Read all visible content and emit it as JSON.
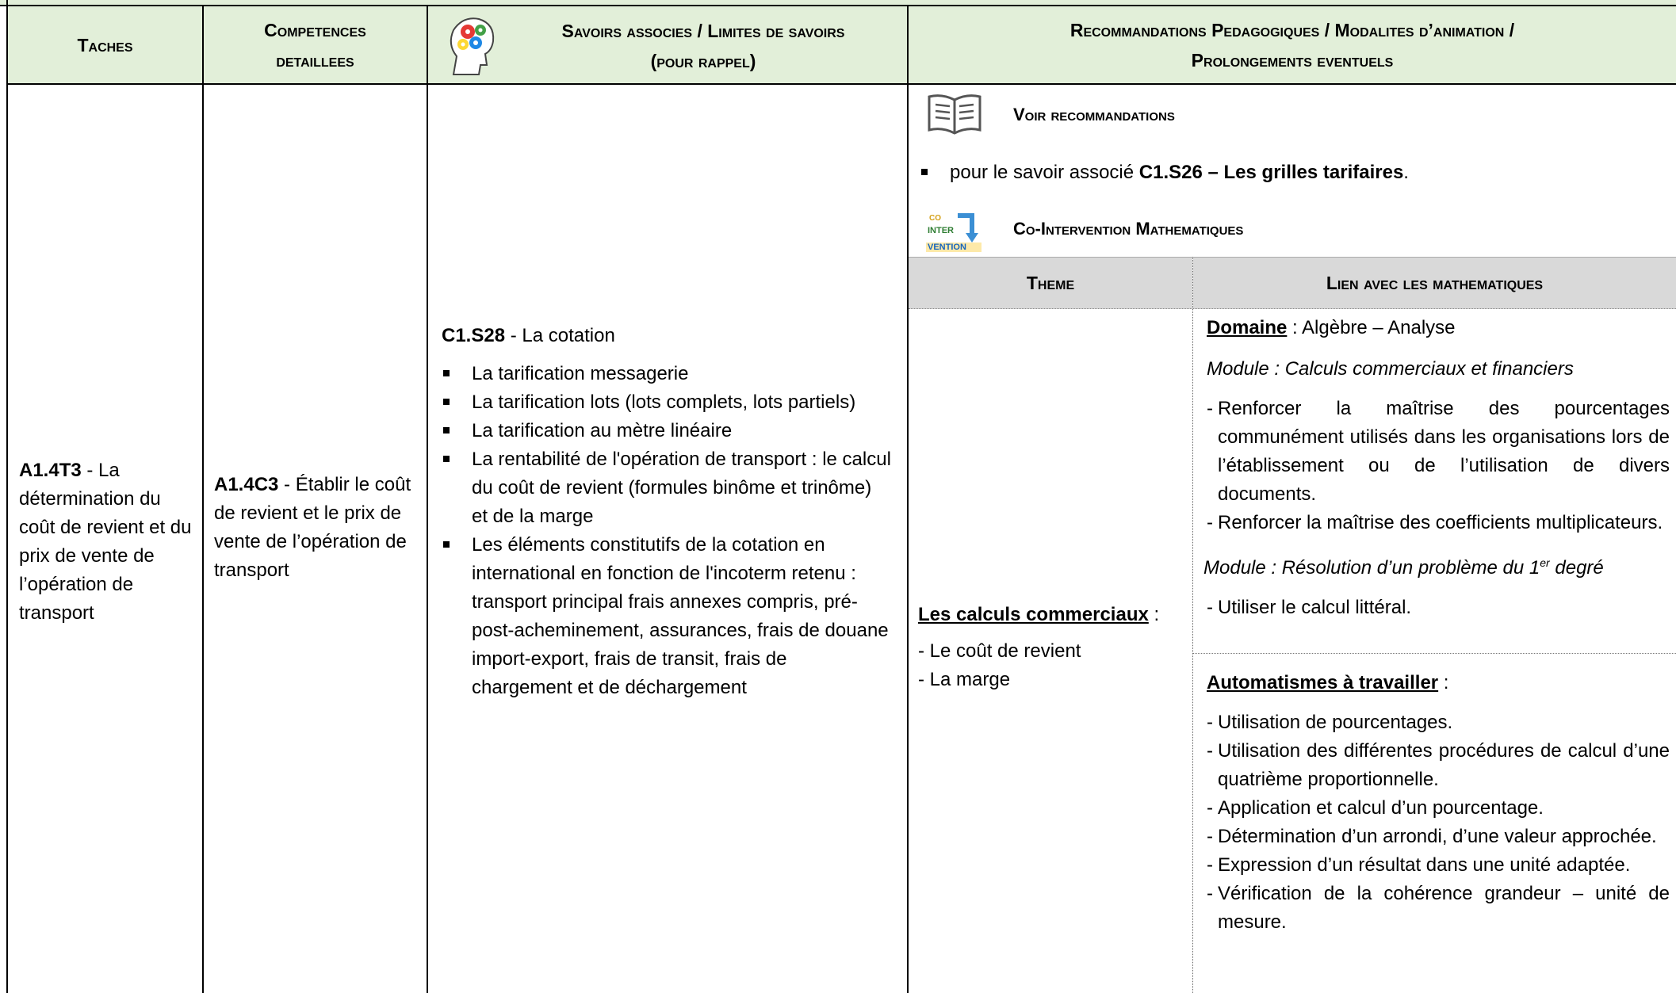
{
  "header": {
    "col1": "Taches",
    "col2_line1": "Competences",
    "col2_line2": "detaillees",
    "col3_line1": "Savoirs associes / Limites de savoirs",
    "col3_line2": "(pour rappel)",
    "col4_line1": "Recommandations Pedagogiques / Modalites d’animation /",
    "col4_line2": "Prolongements eventuels",
    "col3_icon": "brain-gears-icon"
  },
  "taches": {
    "code": "A1.4T3",
    "text": " - La détermination du coût de revient et du prix de vente de l’opération de transport"
  },
  "competences": {
    "code": "A1.4C3",
    "text": " - Établir le coût de revient et le prix de vente de l’opération de transport"
  },
  "savoirs": {
    "code": "C1.S28",
    "title": " - La cotation",
    "items": [
      "La tarification messagerie",
      "La tarification lots (lots complets, lots partiels)",
      "La tarification au mètre linéaire",
      "La rentabilité de l'opération de transport : le calcul du coût de revient (formules binôme et trinôme) et de la marge",
      "Les éléments constitutifs de la cotation en international en fonction de l'incoterm retenu : transport principal frais annexes compris, pré-post-acheminement, assurances, frais de douane import-export, frais de transit, frais de chargement et de déchargement"
    ]
  },
  "reco": {
    "voir_title": "Voir recommandations",
    "voir_icon": "open-book-icon",
    "voir_item_prefix": "pour le savoir associé ",
    "voir_item_bold": "C1.S26 – Les grilles tarifaires",
    "voir_item_suffix": ".",
    "co_title": "Co-Intervention Mathematiques",
    "co_icon_lines": [
      "CO",
      "INTER",
      "VENTION"
    ],
    "table": {
      "col_theme": "Theme",
      "col_lien": "Lien avec les mathematiques",
      "theme_title": "Les calculs commerciaux",
      "theme_colon": " :",
      "theme_items": [
        "- Le coût de revient",
        "- La marge"
      ],
      "domaine_label": "Domaine",
      "domaine_value": " : Algèbre – Analyse",
      "module1": "Module : Calculs commerciaux et financiers",
      "module1_items": [
        "Renforcer la maîtrise des pourcentages communément utilisés dans les organisations lors de l’établissement ou de l’utilisation de divers documents.",
        "Renforcer la maîtrise des coefficients multiplicateurs."
      ],
      "module2_prefix": "Module : Résolution d’un problème du 1",
      "module2_sup": "er",
      "module2_suffix": " degré",
      "module2_items": [
        "Utiliser le calcul littéral."
      ],
      "auto_label": "Automatismes à travailler",
      "auto_colon": " :",
      "auto_items": [
        "Utilisation de pourcentages.",
        "Utilisation des différentes procédures de calcul d’une quatrième proportionnelle.",
        "Application et calcul d’un pourcentage.",
        "Détermination d’un arrondi, d’une valeur approchée.",
        "Expression d’un résultat dans une unité adaptée.",
        "Vérification de la cohérence grandeur – unité de mesure."
      ]
    }
  }
}
